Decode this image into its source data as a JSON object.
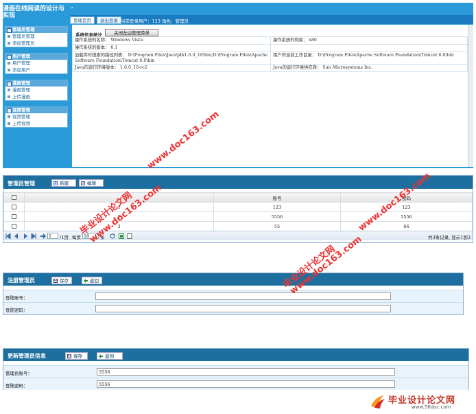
{
  "admin": {
    "app_title": "漫画在线阅读的设计与实现",
    "title_quote": "\"",
    "tabs": [
      "管理首页",
      "退出登录"
    ],
    "login_info": "当前登录用户：123 角色：管理员",
    "sidebar": [
      {
        "title": "管理员管理",
        "items": [
          "管理员管理",
          "添加管理员"
        ]
      },
      {
        "title": "用户管理",
        "items": [
          "用户管理",
          "添加用户"
        ]
      },
      {
        "title": "漫画管理",
        "items": [
          "漫画管理",
          "上传漫画"
        ]
      },
      {
        "title": "视频管理",
        "items": [
          "视频管理",
          "上传视频"
        ]
      }
    ],
    "stats": {
      "title": "系统信息统计",
      "close_button": "关闭左边管理菜单",
      "rows": [
        [
          "操作系统的名称：  Windows Vista",
          "操作系统的构架：  x86"
        ],
        [
          "操作系统的版本：  6.1",
          ""
        ],
        [
          "加载库时搜索的路径列表：  D:\\Program Files\\Java\\jdk1.6.0_10\\bin;D:\\Program Files\\Apache Software Foundation\\Tomcat 6.0\\bin",
          "用户的当前工作目录：  D:\\Program Files\\Apache Software Foundation\\Tomcat 6.0\\bin"
        ],
        [
          "Java的运行环境版本：  1.6.0_10-rc2",
          "Java的运行环境供应商：  Sun Microsystems Inc."
        ]
      ]
    }
  },
  "grid": {
    "title": "管理员管理",
    "new_button": "新建",
    "edit_button": "编辑",
    "columns": [
      "",
      "",
      "账号",
      "密码"
    ],
    "rows": [
      {
        "id": "1",
        "account": "123",
        "password": "123"
      },
      {
        "id": "2",
        "account": "5556",
        "password": "5556"
      },
      {
        "id": "3",
        "account": "55",
        "password": "66"
      }
    ],
    "pager": {
      "page_input": "1",
      "page_total": "/1页",
      "per_page_label": "每页",
      "per_page": "10",
      "per_page_unit": "条",
      "summary": "共3条记录, 显示1到3"
    }
  },
  "register": {
    "title": "注册管理员",
    "save": "保存",
    "back": "返回",
    "fields": [
      {
        "label": "登陆账号：",
        "value": ""
      },
      {
        "label": "登陆密码：",
        "value": ""
      }
    ]
  },
  "update": {
    "title": "更新管理员信息",
    "save": "保存",
    "back": "返回",
    "fields": [
      {
        "label": "管理员账号：",
        "value": "5556"
      },
      {
        "label": "登陆密码：",
        "value": "5556"
      }
    ]
  },
  "watermarks": {
    "site_text": "毕业设计论文网",
    "url_text": "www.doc163.com",
    "logo_text": "毕业设计论文网",
    "logo_url": "www.56doc.com"
  },
  "colors": {
    "frame_blue": "#2a9ad8",
    "header_dark": "#1d6f9f",
    "watermark_red": "#e33"
  }
}
